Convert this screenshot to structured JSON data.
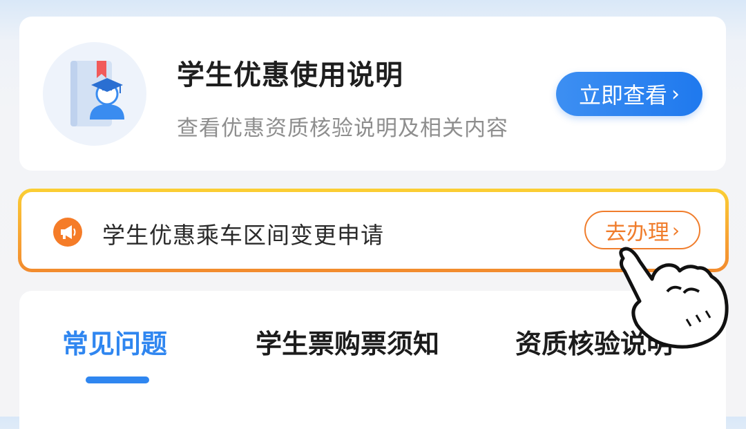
{
  "guide_card": {
    "title": "学生优惠使用说明",
    "subtitle": "查看优惠资质核验说明及相关内容",
    "button_label": "立即查看",
    "button_chevron": "›",
    "icon": "student-book-icon"
  },
  "notice_card": {
    "icon": "megaphone-icon",
    "text": "学生优惠乘车区间变更申请",
    "button_label": "去办理",
    "button_chevron": "›"
  },
  "tabs": {
    "items": [
      {
        "label": "常见问题",
        "active": true
      },
      {
        "label": "学生票购票须知",
        "active": false
      },
      {
        "label": "资质核验说明",
        "active": false
      }
    ]
  },
  "colors": {
    "primary_blue": "#2f86f0",
    "accent_orange": "#f07d2c",
    "border_yellow": "#fbcf34"
  },
  "overlay": {
    "icon": "pointing-hand-icon"
  }
}
